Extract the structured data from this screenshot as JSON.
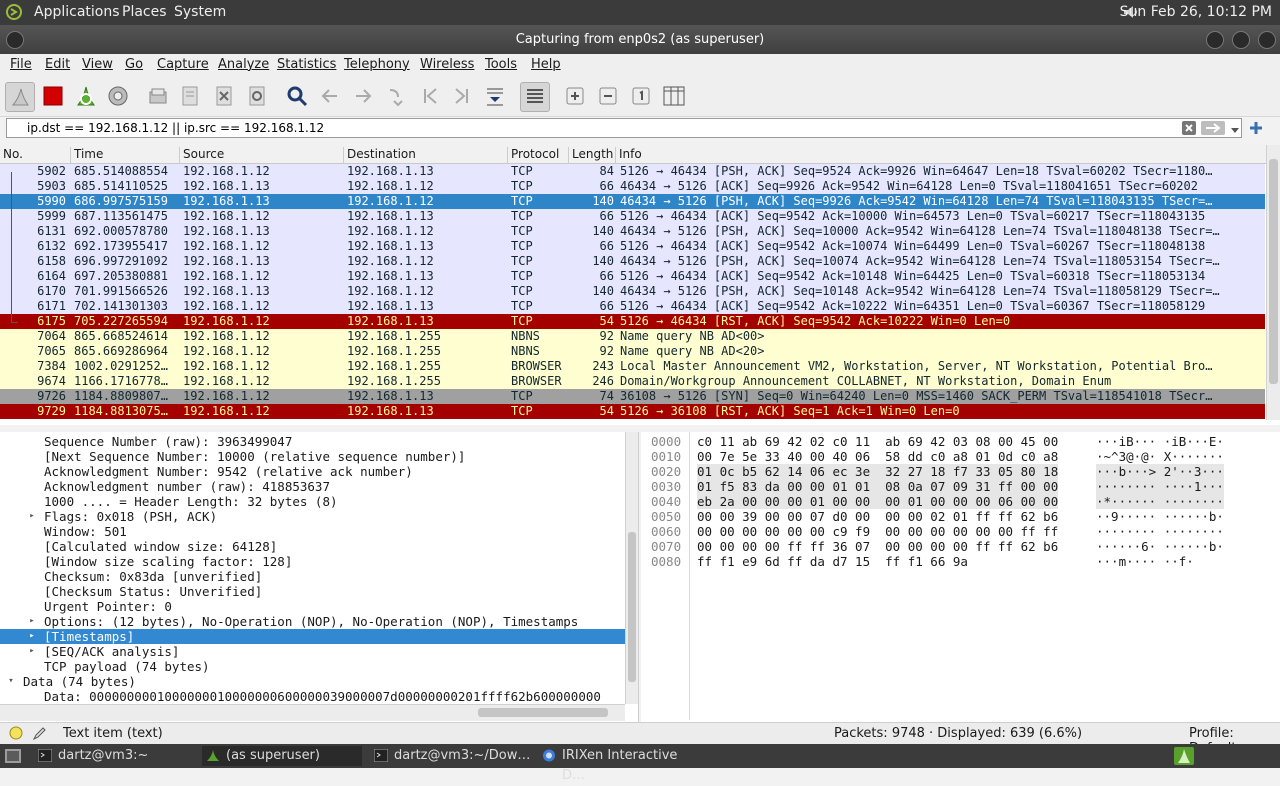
{
  "top_panel": {
    "menus": [
      "Applications",
      "Places",
      "System"
    ],
    "clock": "Sun Feb 26, 10:12 PM"
  },
  "window": {
    "title": "Capturing from enp0s2 (as superuser)"
  },
  "menubar": [
    "File",
    "Edit",
    "View",
    "Go",
    "Capture",
    "Analyze",
    "Statistics",
    "Telephony",
    "Wireless",
    "Tools",
    "Help"
  ],
  "toolbar": [
    "shark-fin-start-icon",
    "stop-capture-icon",
    "restart-capture-icon",
    "capture-options-icon",
    "open-file-icon",
    "save-file-icon",
    "close-file-icon",
    "reload-file-icon",
    "find-packet-icon",
    "go-back-icon",
    "go-forward-icon",
    "go-to-packet-icon",
    "first-packet-icon",
    "last-packet-icon",
    "auto-scroll-icon",
    "colorize-icon",
    "zoom-in-icon",
    "zoom-out-icon",
    "normal-size-icon",
    "resize-columns-icon"
  ],
  "filter": {
    "value": "ip.dst == 192.168.1.12 || ip.src == 192.168.1.12"
  },
  "packet_list": {
    "columns": [
      "No.",
      "Time",
      "Source",
      "Destination",
      "Protocol",
      "Length",
      "Info"
    ],
    "rows": [
      {
        "no": "5902",
        "time": "685.514088554",
        "src": "192.168.1.12",
        "dst": "192.168.1.13",
        "proto": "TCP",
        "len": "84",
        "info": "5126 → 46434 [PSH, ACK] Seq=9524 Ack=9926 Win=64647 Len=18 TSval=60202 TSecr=1180…",
        "bg": "#e7e6ff",
        "fg": "#12272e"
      },
      {
        "no": "5903",
        "time": "685.514110525",
        "src": "192.168.1.13",
        "dst": "192.168.1.12",
        "proto": "TCP",
        "len": "66",
        "info": "46434 → 5126 [ACK] Seq=9926 Ack=9542 Win=64128 Len=0 TSval=118041651 TSecr=60202",
        "bg": "#e7e6ff",
        "fg": "#12272e"
      },
      {
        "no": "5990",
        "time": "686.997575159",
        "src": "192.168.1.13",
        "dst": "192.168.1.12",
        "proto": "TCP",
        "len": "140",
        "info": "46434 → 5126 [PSH, ACK] Seq=9926 Ack=9542 Win=64128 Len=74 TSval=118043135 TSecr=…",
        "bg": "#2e86c9",
        "fg": "#ffffff"
      },
      {
        "no": "5999",
        "time": "687.113561475",
        "src": "192.168.1.12",
        "dst": "192.168.1.13",
        "proto": "TCP",
        "len": "66",
        "info": "5126 → 46434 [ACK] Seq=9542 Ack=10000 Win=64573 Len=0 TSval=60217 TSecr=118043135",
        "bg": "#e7e6ff",
        "fg": "#12272e"
      },
      {
        "no": "6131",
        "time": "692.000578780",
        "src": "192.168.1.13",
        "dst": "192.168.1.12",
        "proto": "TCP",
        "len": "140",
        "info": "46434 → 5126 [PSH, ACK] Seq=10000 Ack=9542 Win=64128 Len=74 TSval=118048138 TSecr=…",
        "bg": "#e7e6ff",
        "fg": "#12272e"
      },
      {
        "no": "6132",
        "time": "692.173955417",
        "src": "192.168.1.12",
        "dst": "192.168.1.13",
        "proto": "TCP",
        "len": "66",
        "info": "5126 → 46434 [ACK] Seq=9542 Ack=10074 Win=64499 Len=0 TSval=60267 TSecr=118048138",
        "bg": "#e7e6ff",
        "fg": "#12272e"
      },
      {
        "no": "6158",
        "time": "696.997291092",
        "src": "192.168.1.13",
        "dst": "192.168.1.12",
        "proto": "TCP",
        "len": "140",
        "info": "46434 → 5126 [PSH, ACK] Seq=10074 Ack=9542 Win=64128 Len=74 TSval=118053154 TSecr=…",
        "bg": "#e7e6ff",
        "fg": "#12272e"
      },
      {
        "no": "6164",
        "time": "697.205380881",
        "src": "192.168.1.12",
        "dst": "192.168.1.13",
        "proto": "TCP",
        "len": "66",
        "info": "5126 → 46434 [ACK] Seq=9542 Ack=10148 Win=64425 Len=0 TSval=60318 TSecr=118053134",
        "bg": "#e7e6ff",
        "fg": "#12272e"
      },
      {
        "no": "6170",
        "time": "701.991566526",
        "src": "192.168.1.13",
        "dst": "192.168.1.12",
        "proto": "TCP",
        "len": "140",
        "info": "46434 → 5126 [PSH, ACK] Seq=10148 Ack=9542 Win=64128 Len=74 TSval=118058129 TSecr=…",
        "bg": "#e7e6ff",
        "fg": "#12272e"
      },
      {
        "no": "6171",
        "time": "702.141301303",
        "src": "192.168.1.12",
        "dst": "192.168.1.13",
        "proto": "TCP",
        "len": "66",
        "info": "5126 → 46434 [ACK] Seq=9542 Ack=10222 Win=64351 Len=0 TSval=60367 TSecr=118058129",
        "bg": "#e7e6ff",
        "fg": "#12272e"
      },
      {
        "no": "6175",
        "time": "705.227265594",
        "src": "192.168.1.12",
        "dst": "192.168.1.13",
        "proto": "TCP",
        "len": "54",
        "info": "5126 → 46434 [RST, ACK] Seq=9542 Ack=10222 Win=0 Len=0",
        "bg": "#a40000",
        "fg": "#fffc9c"
      },
      {
        "no": "7064",
        "time": "865.668524614",
        "src": "192.168.1.12",
        "dst": "192.168.1.255",
        "proto": "NBNS",
        "len": "92",
        "info": "Name query NB AD<00>",
        "bg": "#fefed0",
        "fg": "#12272e"
      },
      {
        "no": "7065",
        "time": "865.669286964",
        "src": "192.168.1.12",
        "dst": "192.168.1.255",
        "proto": "NBNS",
        "len": "92",
        "info": "Name query NB AD<20>",
        "bg": "#fefed0",
        "fg": "#12272e"
      },
      {
        "no": "7384",
        "time": "1002.0291252…",
        "src": "192.168.1.12",
        "dst": "192.168.1.255",
        "proto": "BROWSER",
        "len": "243",
        "info": "Local Master Announcement VM2, Workstation, Server, NT Workstation, Potential Bro…",
        "bg": "#fefed0",
        "fg": "#12272e"
      },
      {
        "no": "9674",
        "time": "1166.1716778…",
        "src": "192.168.1.12",
        "dst": "192.168.1.255",
        "proto": "BROWSER",
        "len": "246",
        "info": "Domain/Workgroup Announcement COLLABNET, NT Workstation, Domain Enum",
        "bg": "#fefed0",
        "fg": "#12272e"
      },
      {
        "no": "9726",
        "time": "1184.8809807…",
        "src": "192.168.1.12",
        "dst": "192.168.1.13",
        "proto": "TCP",
        "len": "74",
        "info": "36108 → 5126 [SYN] Seq=0 Win=64240 Len=0 MSS=1460 SACK_PERM TSval=118541018 TSecr…",
        "bg": "#a0a0a0",
        "fg": "#12272e"
      },
      {
        "no": "9729",
        "time": "1184.8813075…",
        "src": "192.168.1.12",
        "dst": "192.168.1.13",
        "proto": "TCP",
        "len": "54",
        "info": "5126 → 36108 [RST, ACK] Seq=1 Ack=1 Win=0 Len=0",
        "bg": "#a40000",
        "fg": "#fffc9c"
      }
    ]
  },
  "details": [
    {
      "indent": 1,
      "arrow": "",
      "text": "Sequence Number (raw): 3963499047"
    },
    {
      "indent": 1,
      "arrow": "",
      "text": "[Next Sequence Number: 10000    (relative sequence number)]"
    },
    {
      "indent": 1,
      "arrow": "",
      "text": "Acknowledgment Number: 9542    (relative ack number)"
    },
    {
      "indent": 1,
      "arrow": "",
      "text": "Acknowledgment number (raw): 418853637"
    },
    {
      "indent": 1,
      "arrow": "",
      "text": "1000 .... = Header Length: 32 bytes (8)"
    },
    {
      "indent": 1,
      "arrow": "▸",
      "text": "Flags: 0x018 (PSH, ACK)"
    },
    {
      "indent": 1,
      "arrow": "",
      "text": "Window: 501"
    },
    {
      "indent": 1,
      "arrow": "",
      "text": "[Calculated window size: 64128]"
    },
    {
      "indent": 1,
      "arrow": "",
      "text": "[Window size scaling factor: 128]"
    },
    {
      "indent": 1,
      "arrow": "",
      "text": "Checksum: 0x83da [unverified]"
    },
    {
      "indent": 1,
      "arrow": "",
      "text": "[Checksum Status: Unverified]"
    },
    {
      "indent": 1,
      "arrow": "",
      "text": "Urgent Pointer: 0"
    },
    {
      "indent": 1,
      "arrow": "▸",
      "text": "Options: (12 bytes), No-Operation (NOP), No-Operation (NOP), Timestamps"
    },
    {
      "indent": 1,
      "arrow": "▸",
      "text": "[Timestamps]",
      "selected": true
    },
    {
      "indent": 1,
      "arrow": "▸",
      "text": "[SEQ/ACK analysis]"
    },
    {
      "indent": 1,
      "arrow": "",
      "text": "TCP payload (74 bytes)"
    },
    {
      "indent": 0,
      "arrow": "▾",
      "text": "Data (74 bytes)"
    },
    {
      "indent": 1,
      "arrow": "",
      "text": "Data: 0000000001000000010000000600000039000007d00000000201ffff62b600000000"
    }
  ],
  "bytes": [
    {
      "off": "0000",
      "hex": "c0 11 ab 69 42 02 c0 11  ab 69 42 03 08 00 45 00",
      "ascii": "···iB··· ·iB···E·"
    },
    {
      "off": "0010",
      "hex": "00 7e 5e 33 40 00 40 06  58 dd c0 a8 01 0d c0 a8",
      "ascii": "·~^3@·@· X·······"
    },
    {
      "off": "0020",
      "hex": "01 0c b5 62 14 06 ec 3e  32 27 18 f7 33 05 80 18",
      "ascii": "···b···> 2'··3···"
    },
    {
      "off": "0030",
      "hex": "01 f5 83 da 00 00 01 01  08 0a 07 09 31 ff 00 00",
      "ascii": "········ ····1···"
    },
    {
      "off": "0040",
      "hex": "eb 2a 00 00 00 01 00 00  00 01 00 00 00 06 00 00",
      "ascii": "·*······ ········"
    },
    {
      "off": "0050",
      "hex": "00 00 39 00 00 07 d0 00  00 00 02 01 ff ff 62 b6",
      "ascii": "··9····· ······b·"
    },
    {
      "off": "0060",
      "hex": "00 00 00 00 00 00 c9 f9  00 00 00 00 00 00 ff ff",
      "ascii": "········ ········"
    },
    {
      "off": "0070",
      "hex": "00 00 00 00 ff ff 36 07  00 00 00 00 ff ff 62 b6",
      "ascii": "······6· ······b·"
    },
    {
      "off": "0080",
      "hex": "ff f1 e9 6d ff da d7 15  ff f1 66 9a",
      "ascii": "···m···· ··f·"
    }
  ],
  "status": {
    "item": "Text item (text)",
    "packets": "Packets: 9748 · Displayed: 639 (6.6%)",
    "profile": "Profile: Default"
  },
  "taskbar": [
    {
      "label": "dartz@vm3:~",
      "icon": "terminal-icon",
      "active": false
    },
    {
      "label": "(as superuser)",
      "icon": "wireshark-icon",
      "active": true
    },
    {
      "label": "dartz@vm3:~/Dow…",
      "icon": "terminal-icon",
      "active": false
    },
    {
      "label": "IRIXen Interactive D…",
      "icon": "browser-icon",
      "active": false
    }
  ]
}
